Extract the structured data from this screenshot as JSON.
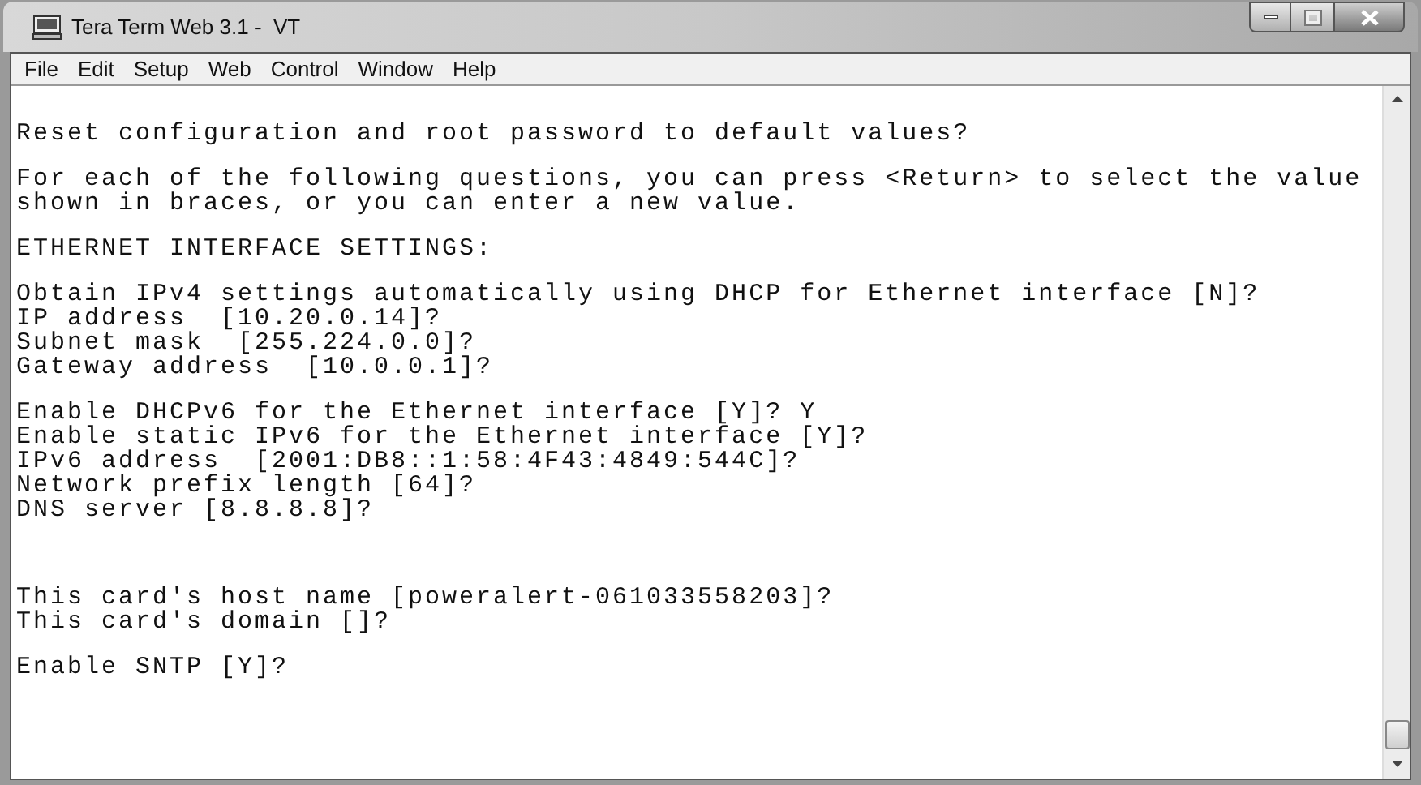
{
  "window": {
    "title": "Tera Term Web 3.1 -  VT"
  },
  "menu": [
    "File",
    "Edit",
    "Setup",
    "Web",
    "Control",
    "Window",
    "Help"
  ],
  "terminal": {
    "blocks": [
      {
        "kind": "text",
        "lines": [
          "Reset configuration and root password to default values?"
        ]
      },
      {
        "kind": "gap"
      },
      {
        "kind": "text",
        "lines": [
          "For each of the following questions, you can press <Return> to select the value",
          "shown in braces, or you can enter a new value."
        ]
      },
      {
        "kind": "gap"
      },
      {
        "kind": "text",
        "lines": [
          "ETHERNET INTERFACE SETTINGS:"
        ]
      },
      {
        "kind": "gap"
      },
      {
        "kind": "text",
        "lines": [
          "Obtain IPv4 settings automatically using DHCP for Ethernet interface [N]?",
          "IP address  [10.20.0.14]?",
          "Subnet mask  [255.224.0.0]?",
          "Gateway address  [10.0.0.1]?"
        ]
      },
      {
        "kind": "gap"
      },
      {
        "kind": "text",
        "lines": [
          "Enable DHCPv6 for the Ethernet interface [Y]? Y",
          "Enable static IPv6 for the Ethernet interface [Y]?",
          "IPv6 address  [2001:DB8::1:58:4F43:4849:544C]?",
          "Network prefix length [64]?",
          "DNS server [8.8.8.8]?"
        ]
      },
      {
        "kind": "gap"
      },
      {
        "kind": "gap"
      },
      {
        "kind": "gap"
      },
      {
        "kind": "text",
        "lines": [
          "This card's host name [poweralert-061033558203]?",
          "This card's domain []?"
        ]
      },
      {
        "kind": "gap"
      },
      {
        "kind": "text",
        "lines": [
          "Enable SNTP [Y]?"
        ]
      }
    ]
  }
}
